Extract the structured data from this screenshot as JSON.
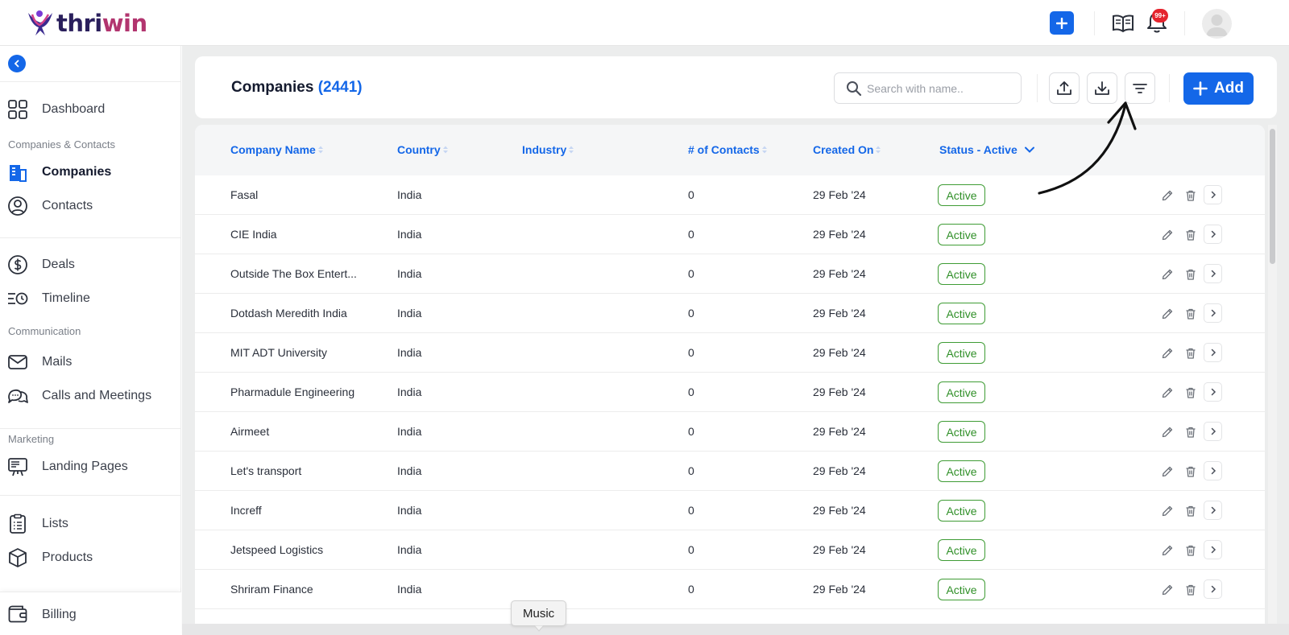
{
  "app": {
    "logo_prefix": "thri",
    "logo_suffix": "win",
    "notifications_badge": "99+"
  },
  "sidebar": {
    "items": [
      {
        "label": "Dashboard",
        "icon": "grid-icon"
      },
      {
        "label": "Companies",
        "icon": "building-icon",
        "active": true
      },
      {
        "label": "Contacts",
        "icon": "user-circle-icon"
      },
      {
        "label": "Deals",
        "icon": "dollar-icon"
      },
      {
        "label": "Timeline",
        "icon": "timeline-icon"
      },
      {
        "label": "Mails",
        "icon": "mail-icon"
      },
      {
        "label": "Calls and Meetings",
        "icon": "chat-icon"
      },
      {
        "label": "Landing Pages",
        "icon": "presentation-icon"
      },
      {
        "label": "Lists",
        "icon": "clipboard-list-icon"
      },
      {
        "label": "Products",
        "icon": "box-icon"
      },
      {
        "label": "Billing",
        "icon": "wallet-icon"
      }
    ],
    "sections": {
      "companies_contacts": "Companies & Contacts",
      "communication": "Communication",
      "marketing": "Marketing"
    }
  },
  "header": {
    "title": "Companies",
    "count": "(2441)",
    "search_placeholder": "Search with name..",
    "add_label": "Add"
  },
  "table": {
    "columns": {
      "company_name": "Company Name",
      "country": "Country",
      "industry": "Industry",
      "contacts": "# of Contacts",
      "created_on": "Created On",
      "status": "Status - Active"
    },
    "rows": [
      {
        "name": "Fasal",
        "country": "India",
        "industry": "",
        "contacts": "0",
        "created": "29 Feb '24",
        "status": "Active"
      },
      {
        "name": "CIE India",
        "country": "India",
        "industry": "",
        "contacts": "0",
        "created": "29 Feb '24",
        "status": "Active"
      },
      {
        "name": "Outside The Box Entert...",
        "country": "India",
        "industry": "",
        "contacts": "0",
        "created": "29 Feb '24",
        "status": "Active"
      },
      {
        "name": "Dotdash Meredith India",
        "country": "India",
        "industry": "",
        "contacts": "0",
        "created": "29 Feb '24",
        "status": "Active"
      },
      {
        "name": "MIT ADT University",
        "country": "India",
        "industry": "",
        "contacts": "0",
        "created": "29 Feb '24",
        "status": "Active"
      },
      {
        "name": "Pharmadule Engineering",
        "country": "India",
        "industry": "",
        "contacts": "0",
        "created": "29 Feb '24",
        "status": "Active"
      },
      {
        "name": "Airmeet",
        "country": "India",
        "industry": "",
        "contacts": "0",
        "created": "29 Feb '24",
        "status": "Active"
      },
      {
        "name": "Let's transport",
        "country": "India",
        "industry": "",
        "contacts": "0",
        "created": "29 Feb '24",
        "status": "Active"
      },
      {
        "name": "Increff",
        "country": "India",
        "industry": "",
        "contacts": "0",
        "created": "29 Feb '24",
        "status": "Active"
      },
      {
        "name": "Jetspeed Logistics",
        "country": "India",
        "industry": "",
        "contacts": "0",
        "created": "29 Feb '24",
        "status": "Active"
      },
      {
        "name": "Shriram Finance",
        "country": "India",
        "industry": "",
        "contacts": "0",
        "created": "29 Feb '24",
        "status": "Active"
      }
    ]
  },
  "tooltip": {
    "text": "Music"
  },
  "colors": {
    "accent": "#1467e8",
    "active_green": "#3f9c35",
    "badge_red": "#e5242e",
    "logo_dark": "#2a1f5c",
    "logo_magenta": "#b2356f"
  }
}
